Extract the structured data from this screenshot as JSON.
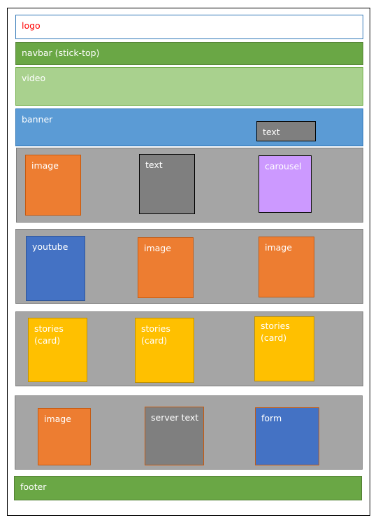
{
  "colors": {
    "navbar_green": "#6aa745",
    "video_green": "#a9d18e",
    "banner_blue": "#5b9bd5",
    "row_gray": "#a5a5a5",
    "text_gray": "#7f7f7f",
    "image_orange": "#ed7d31",
    "carousel_purple": "#cc99ff",
    "youtube_blue": "#4472c4",
    "stories_yellow": "#ffc000",
    "logo_red": "#ff0000"
  },
  "header": {
    "logo": "logo",
    "navbar": "navbar (stick-top)",
    "video": "video"
  },
  "banner": {
    "label": "banner",
    "text": "text"
  },
  "row1": {
    "image": "image",
    "text": "text",
    "carousel": "carousel"
  },
  "row2": {
    "youtube": "youtube",
    "image_a": "image",
    "image_b": "image"
  },
  "row3": {
    "stories_a": "stories\n(card)",
    "stories_b": "stories\n(card)",
    "stories_c": "stories\n(card)"
  },
  "row4": {
    "image": "image",
    "server_text": "server text",
    "form": "form"
  },
  "footer": {
    "label": "footer"
  }
}
